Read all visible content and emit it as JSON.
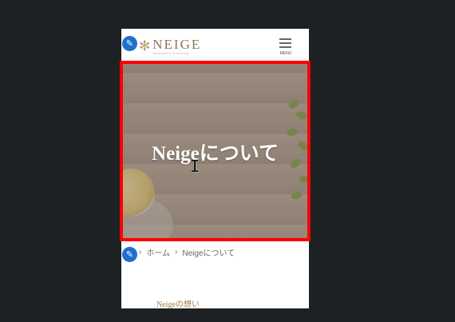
{
  "header": {
    "logo_name": "NEIGE",
    "logo_tagline": "relaxation & beauty",
    "menu_label": "MENU"
  },
  "hero": {
    "title": "Neigeについて"
  },
  "breadcrumb": {
    "separator": "›",
    "home": "ホーム",
    "current": "Neigeについて"
  },
  "section": {
    "title": "Neigeの想い"
  },
  "icons": {
    "edit": "pencil-icon",
    "logo": "snowflake-icon",
    "menu": "hamburger-icon",
    "cursor": "text-cursor-icon"
  },
  "colors": {
    "highlight": "#ff0000",
    "edit_badge": "#1f6fcf",
    "accent": "#a67d3f"
  }
}
